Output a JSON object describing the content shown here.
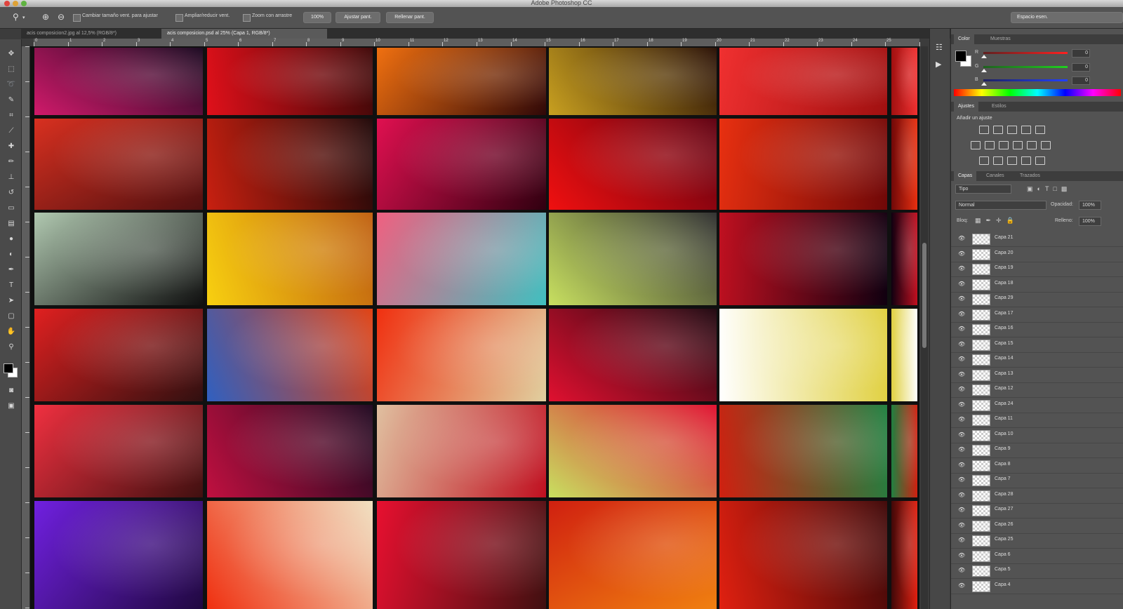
{
  "window": {
    "title": "Adobe Photoshop CC"
  },
  "options_bar": {
    "tool_icon": "zoom-tool-icon",
    "checkboxes": [
      {
        "label": "Cambiar tamaño vent. para ajustar",
        "checked": true
      },
      {
        "label": "Ampliar/reducir vent.",
        "checked": false
      },
      {
        "label": "Zoom con arrastre",
        "checked": true
      }
    ],
    "zoom_value": "100%",
    "buttons": [
      "Ajustar pant.",
      "Rellenar pant."
    ],
    "workspace": "Espacio esen."
  },
  "doc_tabs": [
    {
      "label": "acis composicion2.jpg al 12,5% (RGB/8*)",
      "active": false
    },
    {
      "label": "acis composicion.psd al 25% (Capa 1, RGB/8*)",
      "active": true
    }
  ],
  "tools": [
    "move-tool-icon",
    "marquee-tool-icon",
    "lasso-tool-icon",
    "quick-select-tool-icon",
    "crop-tool-icon",
    "eyedropper-tool-icon",
    "healing-brush-tool-icon",
    "brush-tool-icon",
    "clone-stamp-tool-icon",
    "history-brush-tool-icon",
    "eraser-tool-icon",
    "gradient-tool-icon",
    "blur-tool-icon",
    "dodge-tool-icon",
    "pen-tool-icon",
    "type-tool-icon",
    "path-select-tool-icon",
    "shape-tool-icon",
    "hand-tool-icon",
    "zoom-tool-icon"
  ],
  "ruler_labels": [
    "0",
    "1",
    "2",
    "3",
    "4",
    "5",
    "6",
    "7",
    "8",
    "9",
    "10",
    "11",
    "12",
    "13",
    "14",
    "15",
    "16",
    "17",
    "18",
    "19",
    "20",
    "21",
    "22",
    "23",
    "24",
    "25"
  ],
  "photos": [
    {
      "c1": "#d01a6a",
      "c2": "#1a0820"
    },
    {
      "c1": "#e0101a",
      "c2": "#400808"
    },
    {
      "c1": "#f07010",
      "c2": "#300808"
    },
    {
      "c1": "#c8a020",
      "c2": "#2a1005"
    },
    {
      "c1": "#f03030",
      "c2": "#a01010"
    },
    {
      "c1": "#d83020",
      "c2": "#501010"
    },
    {
      "c1": "#c82010",
      "c2": "#200808"
    },
    {
      "c1": "#e01050",
      "c2": "#300010"
    },
    {
      "c1": "#f01010",
      "c2": "#600010"
    },
    {
      "c1": "#e83010",
      "c2": "#700808"
    },
    {
      "c1": "#b0c8b0",
      "c2": "#101010"
    },
    {
      "c1": "#f8d010",
      "c2": "#c06010"
    },
    {
      "c1": "#f06080",
      "c2": "#40c0c0"
    },
    {
      "c1": "#c8e060",
      "c2": "#303030"
    },
    {
      "c1": "#c01020",
      "c2": "#100010"
    },
    {
      "c1": "#e02020",
      "c2": "#301010"
    },
    {
      "c1": "#3060c0",
      "c2": "#e04010"
    },
    {
      "c1": "#f03010",
      "c2": "#e0d0a0"
    },
    {
      "c1": "#e01030",
      "c2": "#200810"
    },
    {
      "c1": "#ffffff",
      "c2": "#e0d040"
    },
    {
      "c1": "#f03040",
      "c2": "#401010"
    },
    {
      "c1": "#c01040",
      "c2": "#200820"
    },
    {
      "c1": "#e0c0a0",
      "c2": "#c01020"
    },
    {
      "c1": "#c8e060",
      "c2": "#e01030"
    },
    {
      "c1": "#d02010",
      "c2": "#208040"
    },
    {
      "c1": "#7020e0",
      "c2": "#200840"
    },
    {
      "c1": "#f03010",
      "c2": "#f0e0c0"
    },
    {
      "c1": "#e81030",
      "c2": "#401010"
    },
    {
      "c1": "#d02010",
      "c2": "#f08010"
    },
    {
      "c1": "#e02010",
      "c2": "#400808"
    }
  ],
  "color_panel": {
    "tabs": [
      {
        "label": "Color",
        "active": true
      },
      {
        "label": "Muestras",
        "active": false
      }
    ],
    "channels": [
      {
        "label": "R",
        "value": "0",
        "color": "#ff2020",
        "track": "#602020"
      },
      {
        "label": "G",
        "value": "0",
        "color": "#20d020",
        "track": "#206020"
      },
      {
        "label": "B",
        "value": "0",
        "color": "#2040ff",
        "track": "#202060"
      }
    ]
  },
  "adjustments_panel": {
    "tabs": [
      {
        "label": "Ajustes",
        "active": true
      },
      {
        "label": "Estilos",
        "active": false
      }
    ],
    "heading": "Añadir un ajuste",
    "icons": [
      "brightness-icon",
      "levels-icon",
      "curves-icon",
      "exposure-icon",
      "vibrance-icon",
      "hue-sat-icon",
      "color-balance-icon",
      "bw-icon",
      "photo-filter-icon",
      "channel-mixer-icon",
      "color-lookup-icon",
      "invert-icon",
      "posterize-icon",
      "threshold-icon",
      "gradient-map-icon",
      "selective-color-icon"
    ]
  },
  "layers_panel": {
    "tabs": [
      {
        "label": "Capas",
        "active": true
      },
      {
        "label": "Canales",
        "active": false
      },
      {
        "label": "Trazados",
        "active": false
      }
    ],
    "filter_kind": "Tipo",
    "blend_mode": "Normal",
    "opacity_label": "Opacidad:",
    "opacity_value": "100%",
    "lock_label": "Bloq:",
    "fill_label": "Relleno:",
    "fill_value": "100%",
    "layers": [
      "Capa 21",
      "Capa 20",
      "Capa 19",
      "Capa 18",
      "Capa 29",
      "Capa 17",
      "Capa 16",
      "Capa 15",
      "Capa 14",
      "Capa 13",
      "Capa 12",
      "Capa 24",
      "Capa 11",
      "Capa 10",
      "Capa 9",
      "Capa 8",
      "Capa 7",
      "Capa 28",
      "Capa 27",
      "Capa 26",
      "Capa 25",
      "Capa 6",
      "Capa 5",
      "Capa 4"
    ]
  }
}
